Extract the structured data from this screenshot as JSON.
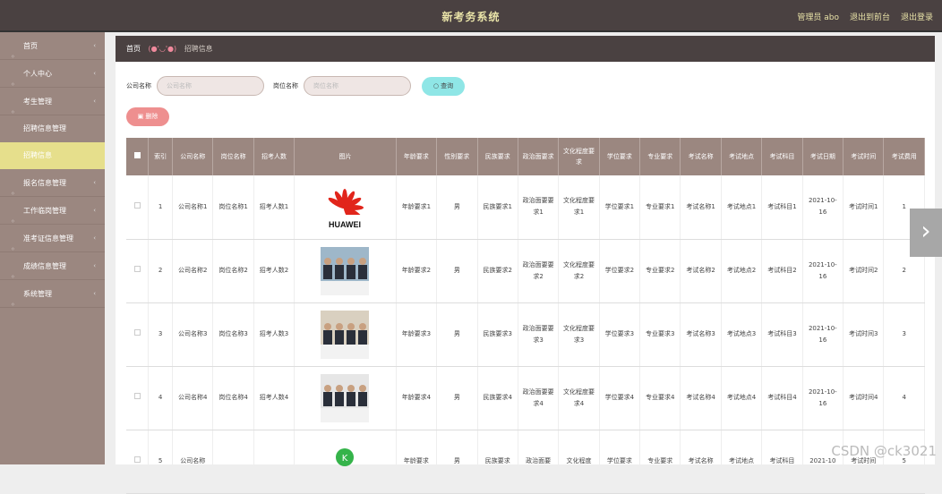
{
  "header": {
    "title": "新考务系统",
    "admin": "管理员 abo",
    "back": "退出到前台",
    "logout": "退出登录"
  },
  "sidebar": {
    "items": [
      {
        "label": "首页",
        "name": "sidebar-item-home"
      },
      {
        "label": "个人中心",
        "name": "sidebar-item-profile"
      },
      {
        "label": "考生管理",
        "name": "sidebar-item-candidates"
      },
      {
        "label": "招聘信息管理",
        "name": "sidebar-item-recruit",
        "sub": true
      },
      {
        "label": "招聘信息",
        "name": "sidebar-item-recruit-info",
        "sub": true,
        "active": true
      },
      {
        "label": "报名信息管理",
        "name": "sidebar-item-signup"
      },
      {
        "label": "工作临岗管理",
        "name": "sidebar-item-work"
      },
      {
        "label": "准考证信息管理",
        "name": "sidebar-item-admission"
      },
      {
        "label": "成绩信息管理",
        "name": "sidebar-item-scores"
      },
      {
        "label": "系统管理",
        "name": "sidebar-item-system"
      }
    ]
  },
  "crumb": {
    "home": "首页",
    "face": "(●'◡'●)",
    "current": "招聘信息"
  },
  "search": {
    "company_label": "公司名称",
    "company_placeholder": "公司名称",
    "job_label": "岗位名称",
    "job_placeholder": "岗位名称",
    "query": "查询"
  },
  "delete": "删除",
  "table": {
    "headers": [
      "索引",
      "公司名称",
      "岗位名称",
      "招考人数",
      "图片",
      "年龄要求",
      "性别要求",
      "民族要求",
      "政治面要求",
      "文化程度要求",
      "学位要求",
      "专业要求",
      "考试名称",
      "考试地点",
      "考试科目",
      "考试日期",
      "考试时间",
      "考试费用"
    ],
    "rows": [
      {
        "idx": "1",
        "company": "公司名称1",
        "job": "岗位名称1",
        "num": "招考人数1",
        "img": "huawei",
        "age": "年龄要求1",
        "sex": "男",
        "nation": "民族要求1",
        "pol": "政治面要要求1",
        "edu": "文化程度要求1",
        "degree": "学位要求1",
        "major": "专业要求1",
        "exam": "考试名称1",
        "place": "考试地点1",
        "subj": "考试科目1",
        "date": "2021-10-16",
        "time": "考试时间1",
        "fee": "1"
      },
      {
        "idx": "2",
        "company": "公司名称2",
        "job": "岗位名称2",
        "num": "招考人数2",
        "img": "interview",
        "age": "年龄要求2",
        "sex": "男",
        "nation": "民族要求2",
        "pol": "政治面要要求2",
        "edu": "文化程度要求2",
        "degree": "学位要求2",
        "major": "专业要求2",
        "exam": "考试名称2",
        "place": "考试地点2",
        "subj": "考试科目2",
        "date": "2021-10-16",
        "time": "考试时间2",
        "fee": "2"
      },
      {
        "idx": "3",
        "company": "公司名称3",
        "job": "岗位名称3",
        "num": "招考人数3",
        "img": "panel",
        "age": "年龄要求3",
        "sex": "男",
        "nation": "民族要求3",
        "pol": "政治面要要求3",
        "edu": "文化程度要求3",
        "degree": "学位要求3",
        "major": "专业要求3",
        "exam": "考试名称3",
        "place": "考试地点3",
        "subj": "考试科目3",
        "date": "2021-10-16",
        "time": "考试时间3",
        "fee": "3"
      },
      {
        "idx": "4",
        "company": "公司名称4",
        "job": "岗位名称4",
        "num": "招考人数4",
        "img": "suits",
        "age": "年龄要求4",
        "sex": "男",
        "nation": "民族要求4",
        "pol": "政治面要要求4",
        "edu": "文化程度要求4",
        "degree": "学位要求4",
        "major": "专业要求4",
        "exam": "考试名称4",
        "place": "考试地点4",
        "subj": "考试科目4",
        "date": "2021-10-16",
        "time": "考试时间4",
        "fee": "4"
      },
      {
        "idx": "5",
        "company": "公司名称",
        "job": "",
        "num": "",
        "img": "logo",
        "age": "年龄要求",
        "sex": "男",
        "nation": "民族要求",
        "pol": "政治面要",
        "edu": "文化程度",
        "degree": "学位要求",
        "major": "专业要求",
        "exam": "考试名称",
        "place": "考试地点",
        "subj": "考试科目",
        "date": "2021-10",
        "time": "考试时间",
        "fee": "5"
      }
    ]
  },
  "watermark": "CSDN @ck3021",
  "colors": {
    "topbar": "#4a4141",
    "sidebar": "#9b8780",
    "active": "#e6df8c",
    "accent": "#e9e3a8"
  }
}
